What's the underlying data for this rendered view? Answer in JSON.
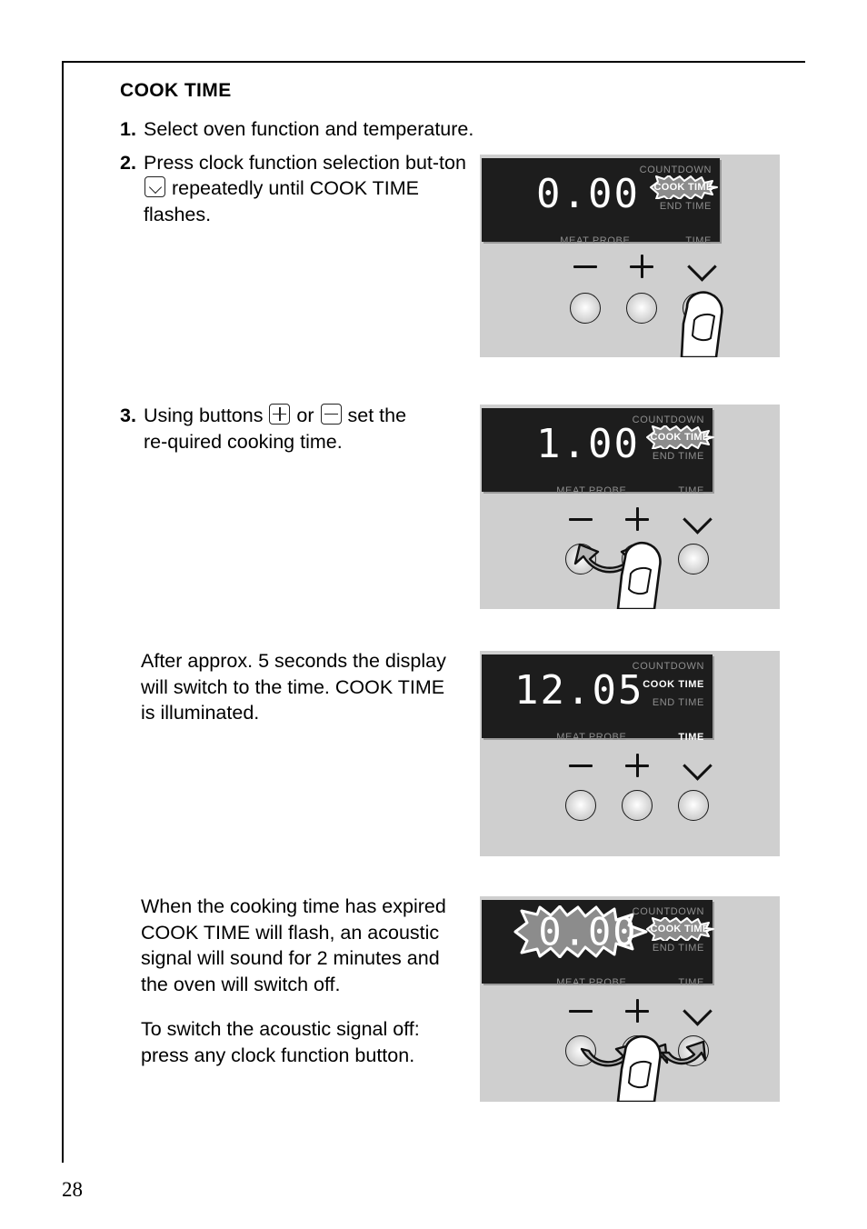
{
  "page": {
    "number": "28"
  },
  "section": {
    "title": "COOK TIME"
  },
  "steps": [
    {
      "num": "1.",
      "text": "Select oven function and temperature."
    },
    {
      "num": "2.",
      "text_before": "Press clock function selection but-ton",
      "icon": "chevron-down-key-icon",
      "text_after": "repeatedly until COOK TIME flashes."
    },
    {
      "num": "3.",
      "text_before": "Using buttons",
      "icon1": "plus-key-icon",
      "text_middle": "or",
      "icon2": "minus-key-icon",
      "text_after": "set the required cooking time."
    }
  ],
  "paragraphs": {
    "after_seconds": "After approx. 5 seconds the display will switch to the time. COOK TIME is illuminated.",
    "expired": "When the cooking time has expired COOK TIME will flash, an acoustic signal will sound for 2 minutes and the oven will switch off.",
    "switch_off": "To switch the acoustic signal off: press any clock function button."
  },
  "panels": [
    {
      "id": "panel-step2",
      "display_value": "0.00",
      "display_flashing": false,
      "labels": [
        {
          "text": "COUNTDOWN",
          "state": "dim"
        },
        {
          "text": "COOK TIME",
          "state": "flashing"
        },
        {
          "text": "END TIME",
          "state": "dim"
        }
      ],
      "bottom_left_label": "MEAT PROBE",
      "bottom_right_label": "TIME",
      "bottom_right_state": "dim",
      "buttons": [
        {
          "symbol": "minus",
          "name": "minus-button"
        },
        {
          "symbol": "plus",
          "name": "plus-button"
        },
        {
          "symbol": "chevron-down",
          "name": "clock-function-button"
        }
      ],
      "finger_on_button": 2,
      "arrows": []
    },
    {
      "id": "panel-step3",
      "display_value": "1.00",
      "display_flashing": false,
      "labels": [
        {
          "text": "COUNTDOWN",
          "state": "dim"
        },
        {
          "text": "COOK TIME",
          "state": "flashing"
        },
        {
          "text": "END TIME",
          "state": "dim"
        }
      ],
      "bottom_left_label": "MEAT PROBE",
      "bottom_right_label": "TIME",
      "bottom_right_state": "dim",
      "buttons": [
        {
          "symbol": "minus",
          "name": "minus-button"
        },
        {
          "symbol": "plus",
          "name": "plus-button"
        },
        {
          "symbol": "chevron-down",
          "name": "clock-function-button"
        }
      ],
      "finger_on_button": 1,
      "arrows": [
        "minus-to-plus-double-arrow"
      ]
    },
    {
      "id": "panel-illuminated",
      "display_value": "12.05",
      "display_flashing": false,
      "labels": [
        {
          "text": "COUNTDOWN",
          "state": "dim"
        },
        {
          "text": "COOK TIME",
          "state": "on"
        },
        {
          "text": "END TIME",
          "state": "dim"
        }
      ],
      "bottom_left_label": "MEAT PROBE",
      "bottom_right_label": "TIME",
      "bottom_right_state": "on",
      "buttons": [
        {
          "symbol": "minus",
          "name": "minus-button"
        },
        {
          "symbol": "plus",
          "name": "plus-button"
        },
        {
          "symbol": "chevron-down",
          "name": "clock-function-button"
        }
      ],
      "finger_on_button": -1,
      "arrows": []
    },
    {
      "id": "panel-expired",
      "display_value": "0.00",
      "display_flashing": true,
      "labels": [
        {
          "text": "COUNTDOWN",
          "state": "dim"
        },
        {
          "text": "COOK TIME",
          "state": "flashing"
        },
        {
          "text": "END TIME",
          "state": "dim"
        }
      ],
      "bottom_left_label": "MEAT PROBE",
      "bottom_right_label": "TIME",
      "bottom_right_state": "dim",
      "buttons": [
        {
          "symbol": "minus",
          "name": "minus-button"
        },
        {
          "symbol": "plus",
          "name": "plus-button"
        },
        {
          "symbol": "chevron-down",
          "name": "clock-function-button"
        }
      ],
      "finger_on_button": 1,
      "arrows": [
        "arrow-to-minus",
        "arrow-to-plus",
        "arrow-to-clock"
      ]
    }
  ],
  "colors": {
    "panel_bg": "#cfcfcf",
    "lcd_bg": "#1d1d1d",
    "label_dim": "#8e8e8e",
    "label_on": "#ffffff",
    "burst_fill": "#8c8c8c"
  }
}
